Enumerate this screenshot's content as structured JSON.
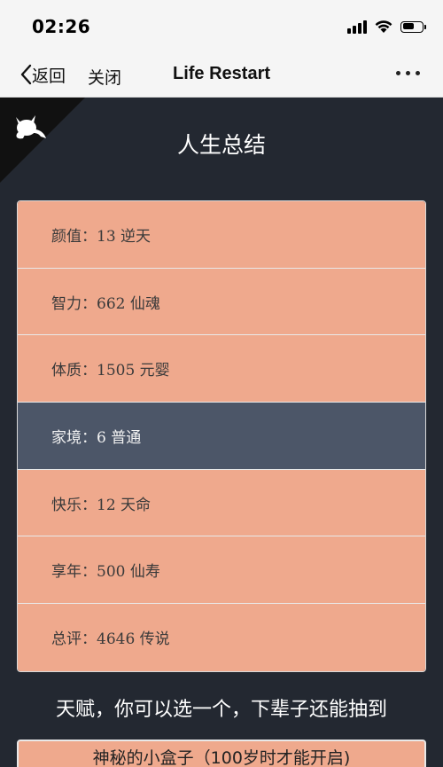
{
  "status_bar": {
    "time": "02:26",
    "icons": [
      "signal-icon",
      "wifi-icon",
      "battery-icon"
    ],
    "battery_level": 0.5
  },
  "nav": {
    "back_label": "返回",
    "close_label": "关闭",
    "title": "Life Restart",
    "more_icon": "more-icon"
  },
  "page": {
    "title": "人生总结"
  },
  "summary": {
    "items": [
      {
        "label": "颜值：13 逆天",
        "style": "orange"
      },
      {
        "label": "智力：662 仙魂",
        "style": "orange"
      },
      {
        "label": "体质：1505 元婴",
        "style": "orange"
      },
      {
        "label": "家境：6 普通",
        "style": "gray"
      },
      {
        "label": "快乐：12 天命",
        "style": "orange"
      },
      {
        "label": "享年：500 仙寿",
        "style": "orange"
      },
      {
        "label": "总评：4646 传说",
        "style": "orange"
      }
    ]
  },
  "talents": {
    "heading": "天赋，你可以选一个，下辈子还能抽到",
    "items": [
      {
        "label": "神秘的小盒子（100岁时才能开启)"
      }
    ]
  },
  "colors": {
    "background": "#232831",
    "orange": "#efa98d",
    "gray": "#4c5668"
  }
}
